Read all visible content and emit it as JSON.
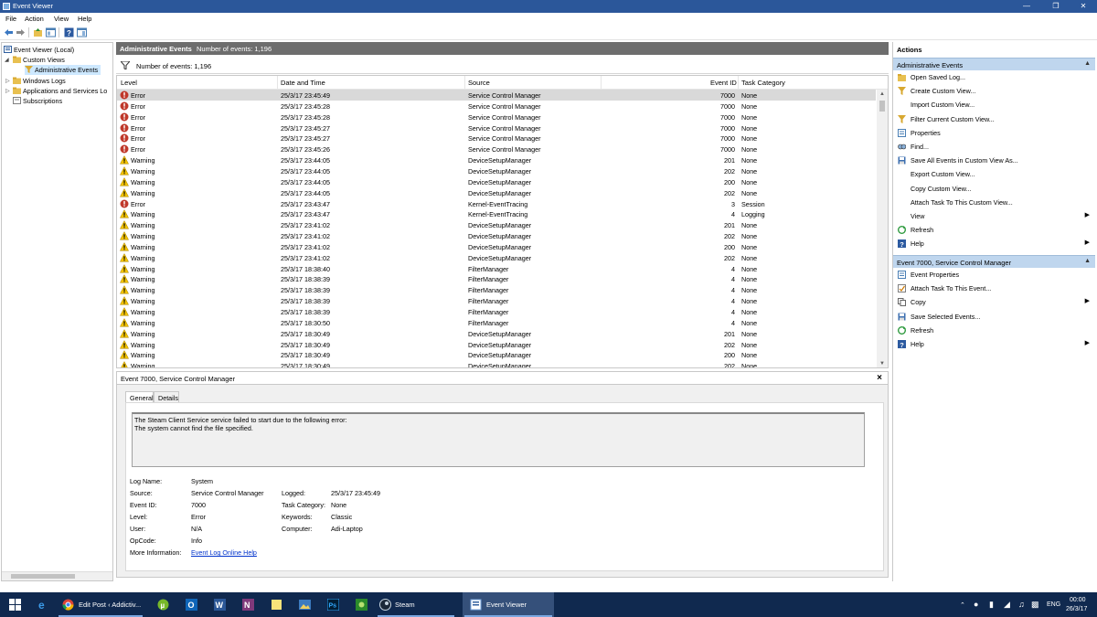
{
  "window": {
    "title": "Event Viewer"
  },
  "menu": [
    "File",
    "Action",
    "View",
    "Help"
  ],
  "tree": {
    "root": "Event Viewer (Local)",
    "custom_views": "Custom Views",
    "admin_events": "Administrative Events",
    "windows_logs": "Windows Logs",
    "apps_services": "Applications and Services Lo",
    "subscriptions": "Subscriptions"
  },
  "center": {
    "title": "Administrative Events",
    "count_label": "Number of events: 1,196",
    "filter_label": "Number of events: 1,196"
  },
  "columns": {
    "level": "Level",
    "datetime": "Date and Time",
    "source": "Source",
    "event_id": "Event ID",
    "category": "Task Category"
  },
  "events": [
    {
      "level": "Error",
      "datetime": "25/3/17 23:45:49",
      "source": "Service Control Manager",
      "id": "7000",
      "category": "None"
    },
    {
      "level": "Error",
      "datetime": "25/3/17 23:45:28",
      "source": "Service Control Manager",
      "id": "7000",
      "category": "None"
    },
    {
      "level": "Error",
      "datetime": "25/3/17 23:45:28",
      "source": "Service Control Manager",
      "id": "7000",
      "category": "None"
    },
    {
      "level": "Error",
      "datetime": "25/3/17 23:45:27",
      "source": "Service Control Manager",
      "id": "7000",
      "category": "None"
    },
    {
      "level": "Error",
      "datetime": "25/3/17 23:45:27",
      "source": "Service Control Manager",
      "id": "7000",
      "category": "None"
    },
    {
      "level": "Error",
      "datetime": "25/3/17 23:45:26",
      "source": "Service Control Manager",
      "id": "7000",
      "category": "None"
    },
    {
      "level": "Warning",
      "datetime": "25/3/17 23:44:05",
      "source": "DeviceSetupManager",
      "id": "201",
      "category": "None"
    },
    {
      "level": "Warning",
      "datetime": "25/3/17 23:44:05",
      "source": "DeviceSetupManager",
      "id": "202",
      "category": "None"
    },
    {
      "level": "Warning",
      "datetime": "25/3/17 23:44:05",
      "source": "DeviceSetupManager",
      "id": "200",
      "category": "None"
    },
    {
      "level": "Warning",
      "datetime": "25/3/17 23:44:05",
      "source": "DeviceSetupManager",
      "id": "202",
      "category": "None"
    },
    {
      "level": "Error",
      "datetime": "25/3/17 23:43:47",
      "source": "Kernel-EventTracing",
      "id": "3",
      "category": "Session"
    },
    {
      "level": "Warning",
      "datetime": "25/3/17 23:43:47",
      "source": "Kernel-EventTracing",
      "id": "4",
      "category": "Logging"
    },
    {
      "level": "Warning",
      "datetime": "25/3/17 23:41:02",
      "source": "DeviceSetupManager",
      "id": "201",
      "category": "None"
    },
    {
      "level": "Warning",
      "datetime": "25/3/17 23:41:02",
      "source": "DeviceSetupManager",
      "id": "202",
      "category": "None"
    },
    {
      "level": "Warning",
      "datetime": "25/3/17 23:41:02",
      "source": "DeviceSetupManager",
      "id": "200",
      "category": "None"
    },
    {
      "level": "Warning",
      "datetime": "25/3/17 23:41:02",
      "source": "DeviceSetupManager",
      "id": "202",
      "category": "None"
    },
    {
      "level": "Warning",
      "datetime": "25/3/17 18:38:40",
      "source": "FilterManager",
      "id": "4",
      "category": "None"
    },
    {
      "level": "Warning",
      "datetime": "25/3/17 18:38:39",
      "source": "FilterManager",
      "id": "4",
      "category": "None"
    },
    {
      "level": "Warning",
      "datetime": "25/3/17 18:38:39",
      "source": "FilterManager",
      "id": "4",
      "category": "None"
    },
    {
      "level": "Warning",
      "datetime": "25/3/17 18:38:39",
      "source": "FilterManager",
      "id": "4",
      "category": "None"
    },
    {
      "level": "Warning",
      "datetime": "25/3/17 18:38:39",
      "source": "FilterManager",
      "id": "4",
      "category": "None"
    },
    {
      "level": "Warning",
      "datetime": "25/3/17 18:30:50",
      "source": "FilterManager",
      "id": "4",
      "category": "None"
    },
    {
      "level": "Warning",
      "datetime": "25/3/17 18:30:49",
      "source": "DeviceSetupManager",
      "id": "201",
      "category": "None"
    },
    {
      "level": "Warning",
      "datetime": "25/3/17 18:30:49",
      "source": "DeviceSetupManager",
      "id": "202",
      "category": "None"
    },
    {
      "level": "Warning",
      "datetime": "25/3/17 18:30:49",
      "source": "DeviceSetupManager",
      "id": "200",
      "category": "None"
    },
    {
      "level": "Warning",
      "datetime": "25/3/17 18:30:49",
      "source": "DeviceSetupManager",
      "id": "202",
      "category": "None"
    }
  ],
  "detail": {
    "title": "Event 7000, Service Control Manager",
    "tab_general": "General",
    "tab_details": "Details",
    "message_line1": "The Steam Client Service service failed to start due to the following error:",
    "message_line2": "The system cannot find the file specified.",
    "labels": {
      "log_name": "Log Name:",
      "source": "Source:",
      "event_id": "Event ID:",
      "level": "Level:",
      "user": "User:",
      "opcode": "OpCode:",
      "more_info": "More Information:",
      "logged": "Logged:",
      "task_category": "Task Category:",
      "keywords": "Keywords:",
      "computer": "Computer:"
    },
    "values": {
      "log_name": "System",
      "source": "Service Control Manager",
      "event_id": "7000",
      "level": "Error",
      "user": "N/A",
      "opcode": "Info",
      "more_info": "Event Log Online Help",
      "logged": "25/3/17 23:45:49",
      "task_category": "None",
      "keywords": "Classic",
      "computer": "Adi-Laptop"
    }
  },
  "actions": {
    "title": "Actions",
    "section1": "Administrative Events",
    "items1": [
      {
        "label": "Open Saved Log...",
        "icon": "folder-icon",
        "arrow": ""
      },
      {
        "label": "Create Custom View...",
        "icon": "funnel-icon",
        "arrow": ""
      },
      {
        "label": "Import Custom View...",
        "icon": "",
        "arrow": ""
      },
      {
        "label": "Filter Current Custom View...",
        "icon": "funnel-icon",
        "arrow": ""
      },
      {
        "label": "Properties",
        "icon": "properties-icon",
        "arrow": ""
      },
      {
        "label": "Find...",
        "icon": "find-icon",
        "arrow": ""
      },
      {
        "label": "Save All Events in Custom View As...",
        "icon": "save-icon",
        "arrow": ""
      },
      {
        "label": "Export Custom View...",
        "icon": "",
        "arrow": ""
      },
      {
        "label": "Copy Custom View...",
        "icon": "",
        "arrow": ""
      },
      {
        "label": "Attach Task To This Custom View...",
        "icon": "",
        "arrow": ""
      },
      {
        "label": "View",
        "icon": "",
        "arrow": "▶"
      },
      {
        "label": "Refresh",
        "icon": "refresh-icon",
        "arrow": ""
      },
      {
        "label": "Help",
        "icon": "help-icon",
        "arrow": "▶"
      }
    ],
    "section2": "Event 7000, Service Control Manager",
    "items2": [
      {
        "label": "Event Properties",
        "icon": "properties-icon",
        "arrow": ""
      },
      {
        "label": "Attach Task To This Event...",
        "icon": "task-icon",
        "arrow": ""
      },
      {
        "label": "Copy",
        "icon": "copy-icon",
        "arrow": "▶"
      },
      {
        "label": "Save Selected Events...",
        "icon": "save-icon",
        "arrow": ""
      },
      {
        "label": "Refresh",
        "icon": "refresh-icon",
        "arrow": ""
      },
      {
        "label": "Help",
        "icon": "help-icon",
        "arrow": "▶"
      }
    ]
  },
  "taskbar": {
    "chrome_label": "Edit Post ‹ Addictiv...",
    "steam_label": "Steam",
    "eventviewer_label": "Event Viewer",
    "lang": "ENG",
    "time": "00:00",
    "date": "26/3/17"
  },
  "colors": {
    "accent": "#2b579a",
    "taskbar": "#10294f",
    "section_bg": "#bfd6ee",
    "error": "#c0392b",
    "warning": "#f2c200"
  }
}
